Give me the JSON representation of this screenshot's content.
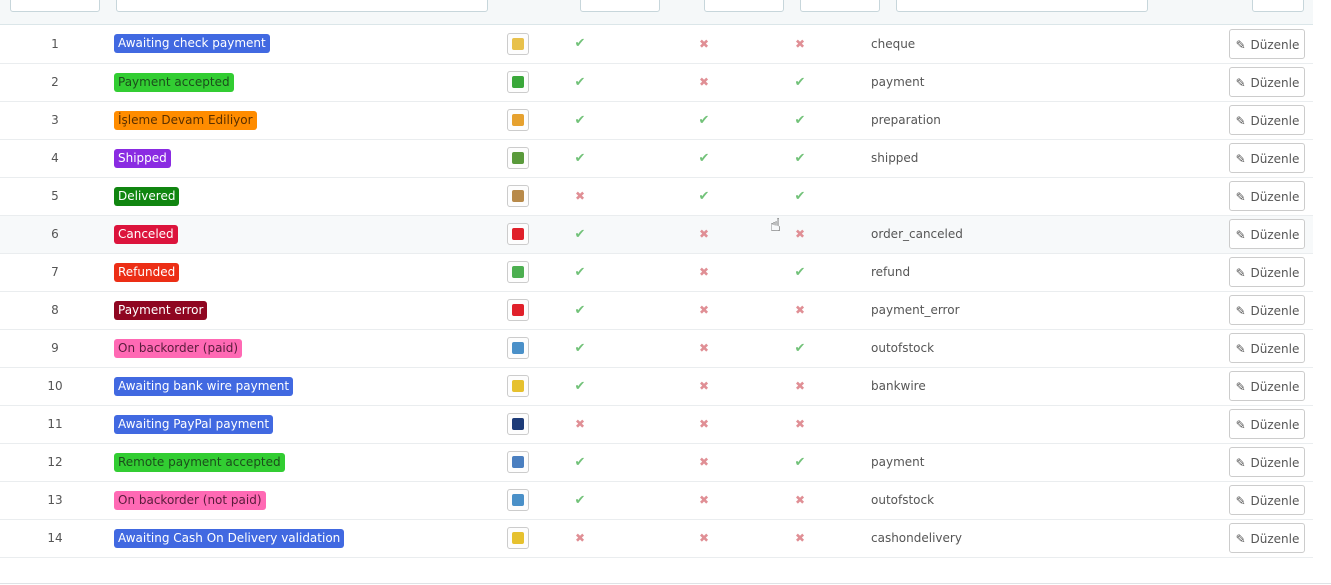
{
  "edit_label": "Düzenle",
  "rows": [
    {
      "id": "1",
      "name": "Awaiting check payment",
      "color": "#4169E1",
      "text": "#ffffff",
      "icon": "check-payment-icon",
      "icolor": "#e8c14b",
      "a": true,
      "b": false,
      "c": false,
      "template": "cheque"
    },
    {
      "id": "2",
      "name": "Payment accepted",
      "color": "#32CD32",
      "text": "#1b4d1b",
      "icon": "accepted-icon",
      "icolor": "#3aa83a",
      "a": true,
      "b": false,
      "c": true,
      "template": "payment"
    },
    {
      "id": "3",
      "name": "İşleme Devam Ediliyor",
      "color": "#FF8C00",
      "text": "#5a3000",
      "icon": "package-icon",
      "icolor": "#e6a12e",
      "a": true,
      "b": true,
      "c": true,
      "template": "preparation"
    },
    {
      "id": "4",
      "name": "Shipped",
      "color": "#8A2BE2",
      "text": "#ffffff",
      "icon": "truck-icon",
      "icolor": "#5a9a3b",
      "a": true,
      "b": true,
      "c": true,
      "template": "shipped"
    },
    {
      "id": "5",
      "name": "Delivered",
      "color": "#108510",
      "text": "#ffffff",
      "icon": "box-icon",
      "icolor": "#b88a4a",
      "a": false,
      "b": true,
      "c": true,
      "template": ""
    },
    {
      "id": "6",
      "name": "Canceled",
      "color": "#DC143C",
      "text": "#ffffff",
      "icon": "cancel-icon",
      "icolor": "#e0202a",
      "a": true,
      "b": false,
      "c": false,
      "template": "order_canceled"
    },
    {
      "id": "7",
      "name": "Refunded",
      "color": "#ec2e15",
      "text": "#ffffff",
      "icon": "money-icon",
      "icolor": "#4caf50",
      "a": true,
      "b": false,
      "c": true,
      "template": "refund"
    },
    {
      "id": "8",
      "name": "Payment error",
      "color": "#8f0621",
      "text": "#ffffff",
      "icon": "error-icon",
      "icolor": "#e0202a",
      "a": true,
      "b": false,
      "c": false,
      "template": "payment_error"
    },
    {
      "id": "9",
      "name": "On backorder (paid)",
      "color": "#FF69B4",
      "text": "#5a1c3c",
      "icon": "backorder-icon",
      "icolor": "#4a90c8",
      "a": true,
      "b": false,
      "c": true,
      "template": "outofstock"
    },
    {
      "id": "10",
      "name": "Awaiting bank wire payment",
      "color": "#4169E1",
      "text": "#ffffff",
      "icon": "coins-icon",
      "icolor": "#e6c12e",
      "a": true,
      "b": false,
      "c": false,
      "template": "bankwire"
    },
    {
      "id": "11",
      "name": "Awaiting PayPal payment",
      "color": "#4169E1",
      "text": "#ffffff",
      "icon": "paypal-icon",
      "icolor": "#1d3b78",
      "a": false,
      "b": false,
      "c": false,
      "template": ""
    },
    {
      "id": "12",
      "name": "Remote payment accepted",
      "color": "#32CD32",
      "text": "#1b4d1b",
      "icon": "remote-icon",
      "icolor": "#4a7fc0",
      "a": true,
      "b": false,
      "c": true,
      "template": "payment"
    },
    {
      "id": "13",
      "name": "On backorder (not paid)",
      "color": "#FF69B4",
      "text": "#5a1c3c",
      "icon": "backorder-icon",
      "icolor": "#4a90c8",
      "a": true,
      "b": false,
      "c": false,
      "template": "outofstock"
    },
    {
      "id": "14",
      "name": "Awaiting Cash On Delivery validation",
      "color": "#4169E1",
      "text": "#ffffff",
      "icon": "coins-icon",
      "icolor": "#e6c12e",
      "a": false,
      "b": false,
      "c": false,
      "template": "cashondelivery"
    }
  ]
}
